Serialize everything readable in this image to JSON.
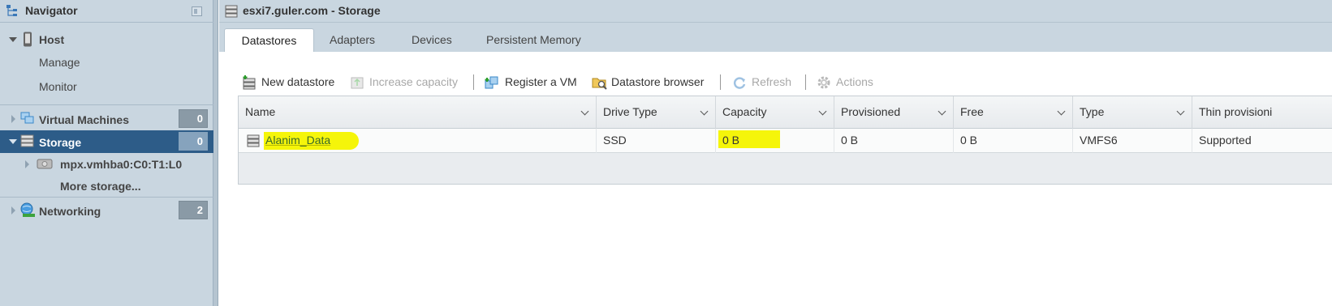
{
  "navigator": {
    "title": "Navigator",
    "host": {
      "label": "Host",
      "children": [
        "Manage",
        "Monitor"
      ]
    },
    "virtual_machines": {
      "label": "Virtual Machines",
      "count": "0"
    },
    "storage": {
      "label": "Storage",
      "count": "0",
      "children": [
        {
          "label": "mpx.vmhba0:C0:T1:L0"
        },
        {
          "label": "More storage..."
        }
      ]
    },
    "networking": {
      "label": "Networking",
      "count": "2"
    }
  },
  "main": {
    "title": "esxi7.guler.com - Storage",
    "tabs": [
      {
        "label": "Datastores",
        "active": true
      },
      {
        "label": "Adapters",
        "active": false
      },
      {
        "label": "Devices",
        "active": false
      },
      {
        "label": "Persistent Memory",
        "active": false
      }
    ],
    "toolbar": {
      "new_datastore": "New datastore",
      "increase_capacity": "Increase capacity",
      "register_vm": "Register a VM",
      "datastore_browser": "Datastore browser",
      "refresh": "Refresh",
      "actions": "Actions"
    },
    "grid": {
      "columns": [
        "Name",
        "Drive Type",
        "Capacity",
        "Provisioned",
        "Free",
        "Type",
        "Thin provisioni"
      ],
      "rows": [
        {
          "name": "Alanim_Data",
          "drive_type": "SSD",
          "capacity": "0 B",
          "provisioned": "0 B",
          "free": "0 B",
          "type": "VMFS6",
          "thin_provisioning": "Supported"
        }
      ]
    }
  },
  "colors": {
    "sidebar_bg": "#c9d6e0",
    "selected_bg": "#2d5c88",
    "highlight": "#f5f50a"
  }
}
